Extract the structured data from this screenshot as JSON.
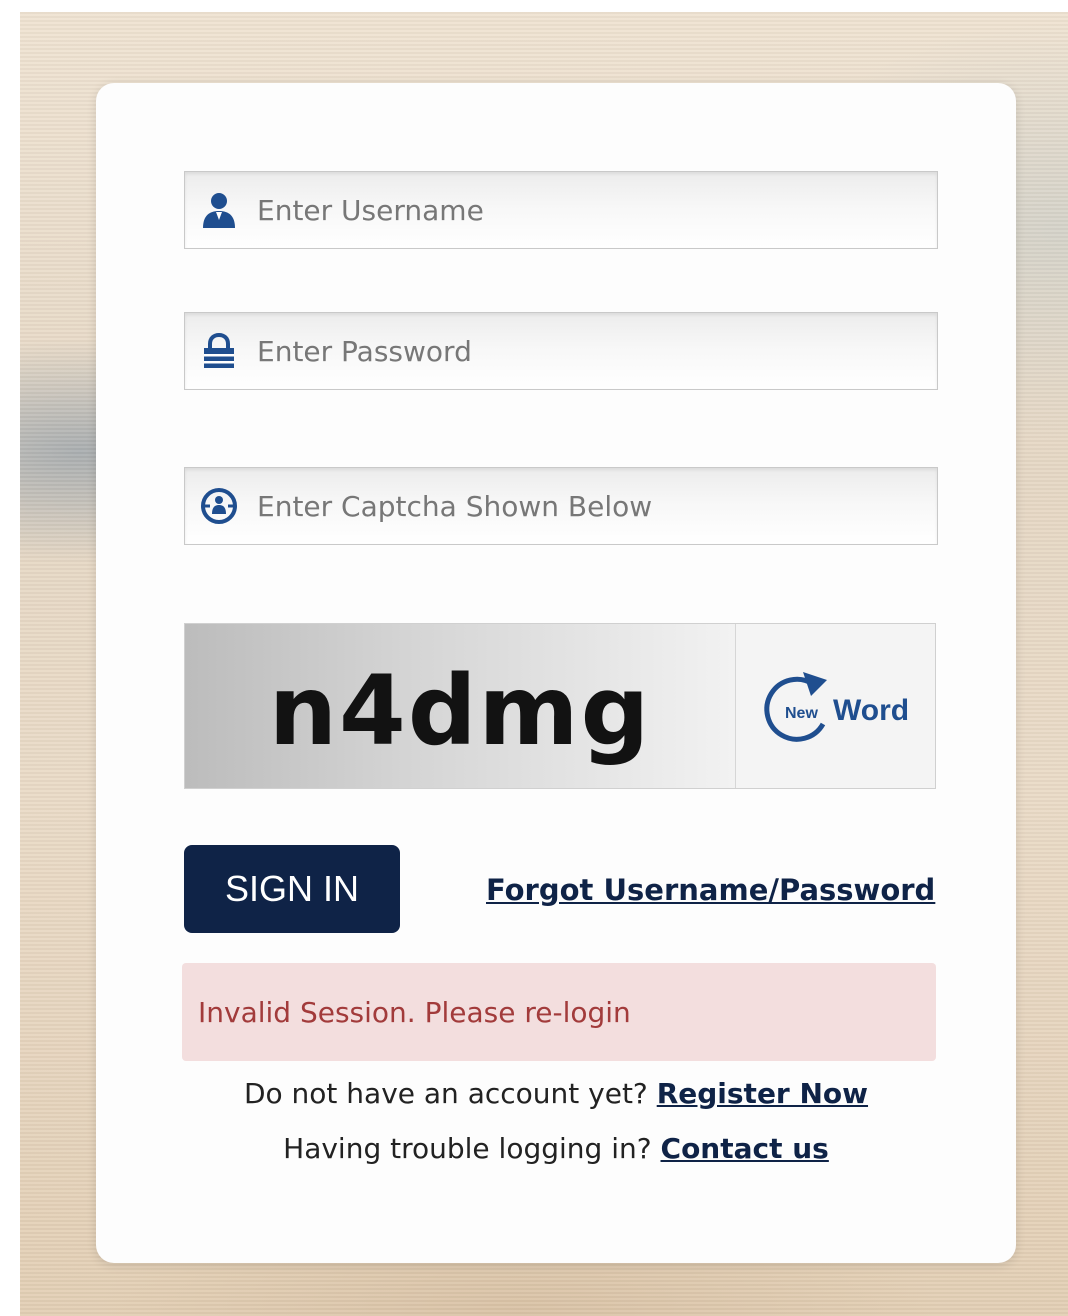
{
  "login": {
    "username_placeholder": "Enter Username",
    "password_placeholder": "Enter Password",
    "captcha_placeholder": "Enter Captcha Shown Below",
    "captcha_text": "n4dmg",
    "refresh_new": "New",
    "refresh_word": "Word",
    "signin_label": "SIGN IN",
    "forgot_label": "Forgot Username/Password",
    "error_message": "Invalid Session. Please re-login",
    "register_prompt": "Do not have an account yet?",
    "register_link": "Register Now",
    "trouble_prompt": "Having trouble logging in?",
    "contact_link": "Contact us"
  },
  "icons": {
    "username": "user-icon",
    "password": "lock-icon",
    "captcha": "captcha-icon",
    "refresh": "refresh-icon"
  },
  "colors": {
    "brand_navy": "#0f2347",
    "icon_blue": "#1f4e8f",
    "error_bg": "#f3dede",
    "error_text": "#a23b3b"
  }
}
